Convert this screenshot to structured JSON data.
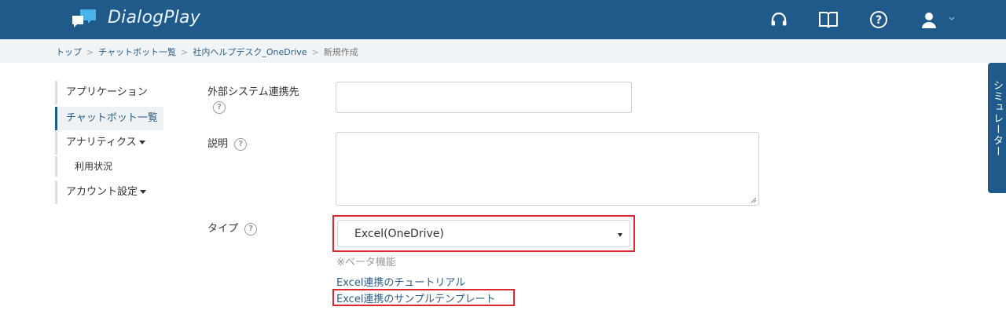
{
  "header": {
    "brand": "DialogPlay",
    "icons": [
      "headset-icon",
      "book-icon",
      "help-icon",
      "user-icon",
      "chevron-down-icon"
    ],
    "colors": {
      "bar": "#1f5a8a",
      "accent": "#2a5d87"
    }
  },
  "breadcrumb": {
    "items": [
      "トップ",
      "チャットボット一覧",
      "社内ヘルプデスク_OneDrive"
    ],
    "current": "新規作成",
    "separator": ">"
  },
  "sidebar": {
    "items": [
      {
        "label": "アプリケーション"
      },
      {
        "label": "チャットボット一覧",
        "active": true
      },
      {
        "label": "アナリティクス"
      },
      {
        "label": "利用状況"
      },
      {
        "label": "アカウント設定"
      }
    ]
  },
  "form": {
    "external_label": "外部システム連携先",
    "external_value": "",
    "description_label": "説明",
    "description_value": "",
    "type_label": "タイプ",
    "type_value": "Excel(OneDrive)",
    "help_glyph": "?",
    "beta_note": "※ベータ機能",
    "tutorial_link": "Excel連携のチュートリアル",
    "template_link": "Excel連携のサンプルテンプレート",
    "highlight_color": "#e0262e"
  },
  "simulator": {
    "label": "シミュレーター"
  }
}
